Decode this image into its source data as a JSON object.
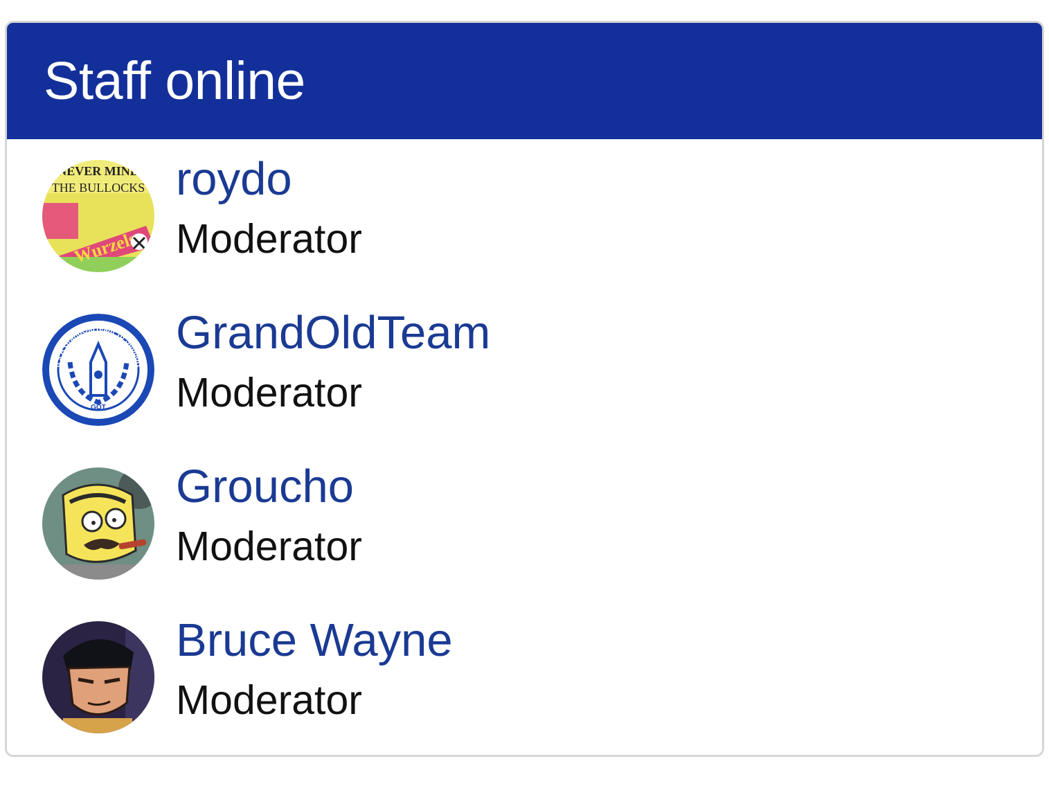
{
  "widget": {
    "title": "Staff online",
    "header_color": "#13309a",
    "link_color": "#1a3a93"
  },
  "members": [
    {
      "name": "roydo",
      "role": "Moderator",
      "avatar_icon": "album-cover-avatar",
      "avatar_text": [
        "NEVER MIND",
        "THE BULLOCKS",
        "Wurzels"
      ]
    },
    {
      "name": "GrandOldTeam",
      "role": "Moderator",
      "avatar_icon": "club-crest-avatar",
      "avatar_text": [
        "It's A GrandOldTeam To Support",
        "GOT"
      ]
    },
    {
      "name": "Groucho",
      "role": "Moderator",
      "avatar_icon": "cartoon-face-avatar"
    },
    {
      "name": "Bruce Wayne",
      "role": "Moderator",
      "avatar_icon": "cartoon-face-avatar"
    }
  ]
}
